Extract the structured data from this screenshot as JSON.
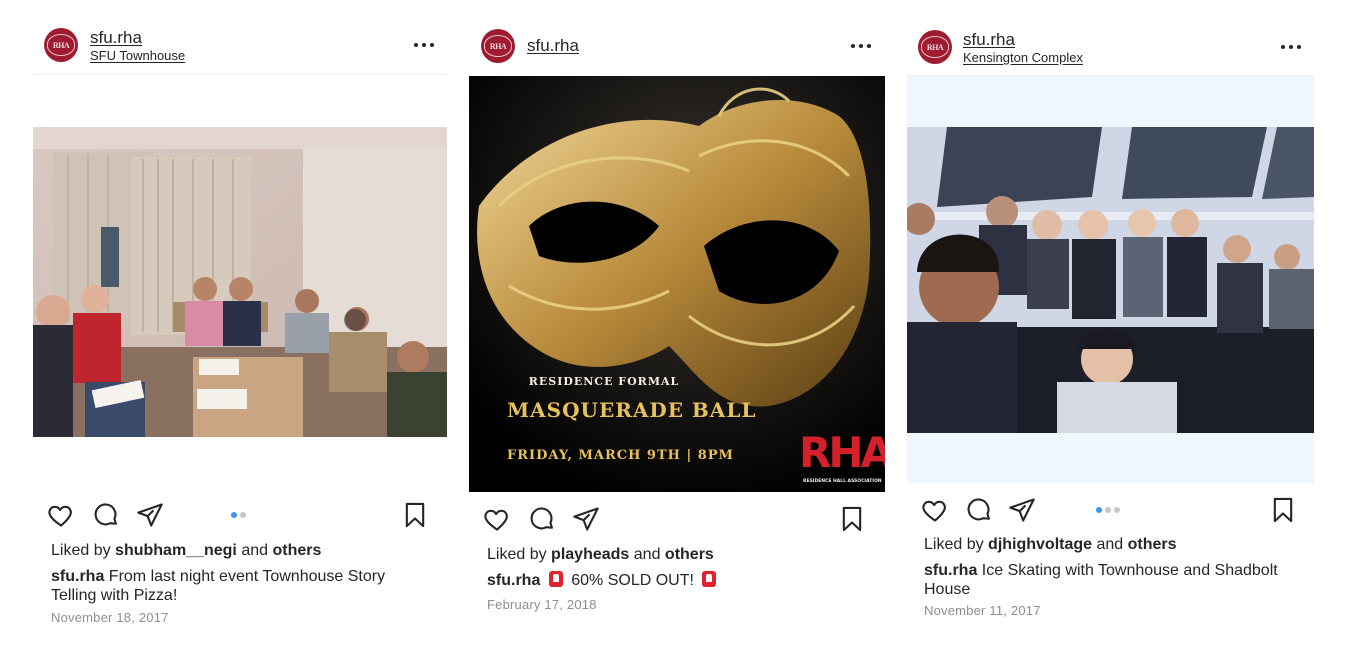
{
  "posts": [
    {
      "username": "sfu.rha",
      "location": "SFU Townhouse",
      "avatar_text": "RHA",
      "liked_by_prefix": "Liked by",
      "liked_by_user": "shubham__negi",
      "liked_by_and": "and",
      "liked_by_others": "others",
      "caption_user": "sfu.rha",
      "caption_text": "From last night event Townhouse Story Telling with Pizza!",
      "date": "November 18, 2017",
      "carousel_pages": 2,
      "carousel_active": 1
    },
    {
      "username": "sfu.rha",
      "location": "",
      "avatar_text": "RHA",
      "liked_by_prefix": "Liked by",
      "liked_by_user": "playheads",
      "liked_by_and": "and",
      "liked_by_others": "others",
      "caption_user": "sfu.rha",
      "caption_text": "60% SOLD OUT!",
      "date": "February 17, 2018",
      "poster": {
        "subtitle": "RESIDENCE FORMAL",
        "title": "MASQUERADE BALL",
        "when": "FRIDAY, MARCH 9TH | 8PM",
        "logo": "RHA",
        "logo_sub": "RESIDENCE HALL ASSOCIATION"
      }
    },
    {
      "username": "sfu.rha",
      "location": "Kensington Complex",
      "avatar_text": "RHA",
      "liked_by_prefix": "Liked by",
      "liked_by_user": "djhighvoltage",
      "liked_by_and": "and",
      "liked_by_others": "others",
      "caption_user": "sfu.rha",
      "caption_text": "Ice Skating with Townhouse and Shadbolt House",
      "date": "November 11, 2017",
      "carousel_pages": 3,
      "carousel_active": 1
    }
  ],
  "colors": {
    "accent": "#3897f0",
    "brand": "#9e1b32",
    "text": "#262626",
    "muted": "#8e8e8e"
  },
  "icons": [
    "heart-icon",
    "comment-icon",
    "share-icon",
    "bookmark-icon",
    "more-icon",
    "siren-emoji"
  ]
}
